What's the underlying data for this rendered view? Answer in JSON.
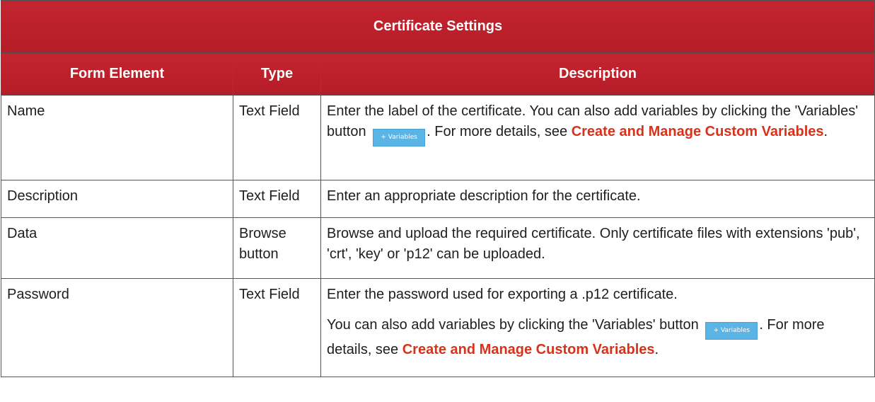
{
  "table": {
    "title": "Certificate Settings",
    "headers": {
      "form_element": "Form Element",
      "type": "Type",
      "description": "Description"
    },
    "variables_button_label": "+ Variables",
    "rows": [
      {
        "element": "Name",
        "type": "Text Field",
        "desc_before": "Enter the label of the certificate. You can also add variables by clicking the 'Variables' button",
        "desc_mid": ". For more details, see",
        "link": "Create and Manage Custom Variables",
        "desc_end": "."
      },
      {
        "element": "Description",
        "type": "Text Field",
        "desc": "Enter an appropriate description for the certificate."
      },
      {
        "element": "Data",
        "type": "Browse button",
        "desc": "Browse and upload the required certificate. Only certificate files with extensions 'pub', 'crt', 'key' or 'p12' can be uploaded."
      },
      {
        "element": "Password",
        "type": "Text Field",
        "desc_p1": "Enter the password used for exporting a .p12 certificate.",
        "desc_p2_before": "You can also add variables by clicking the 'Variables' button",
        "desc_p2_mid": ". For more details, see",
        "link": "Create and Manage Custom Variables",
        "desc_end": "."
      }
    ]
  },
  "colors": {
    "header_red": "#c4242f",
    "link_red": "#d7321b",
    "button_blue": "#5bb4e6"
  }
}
